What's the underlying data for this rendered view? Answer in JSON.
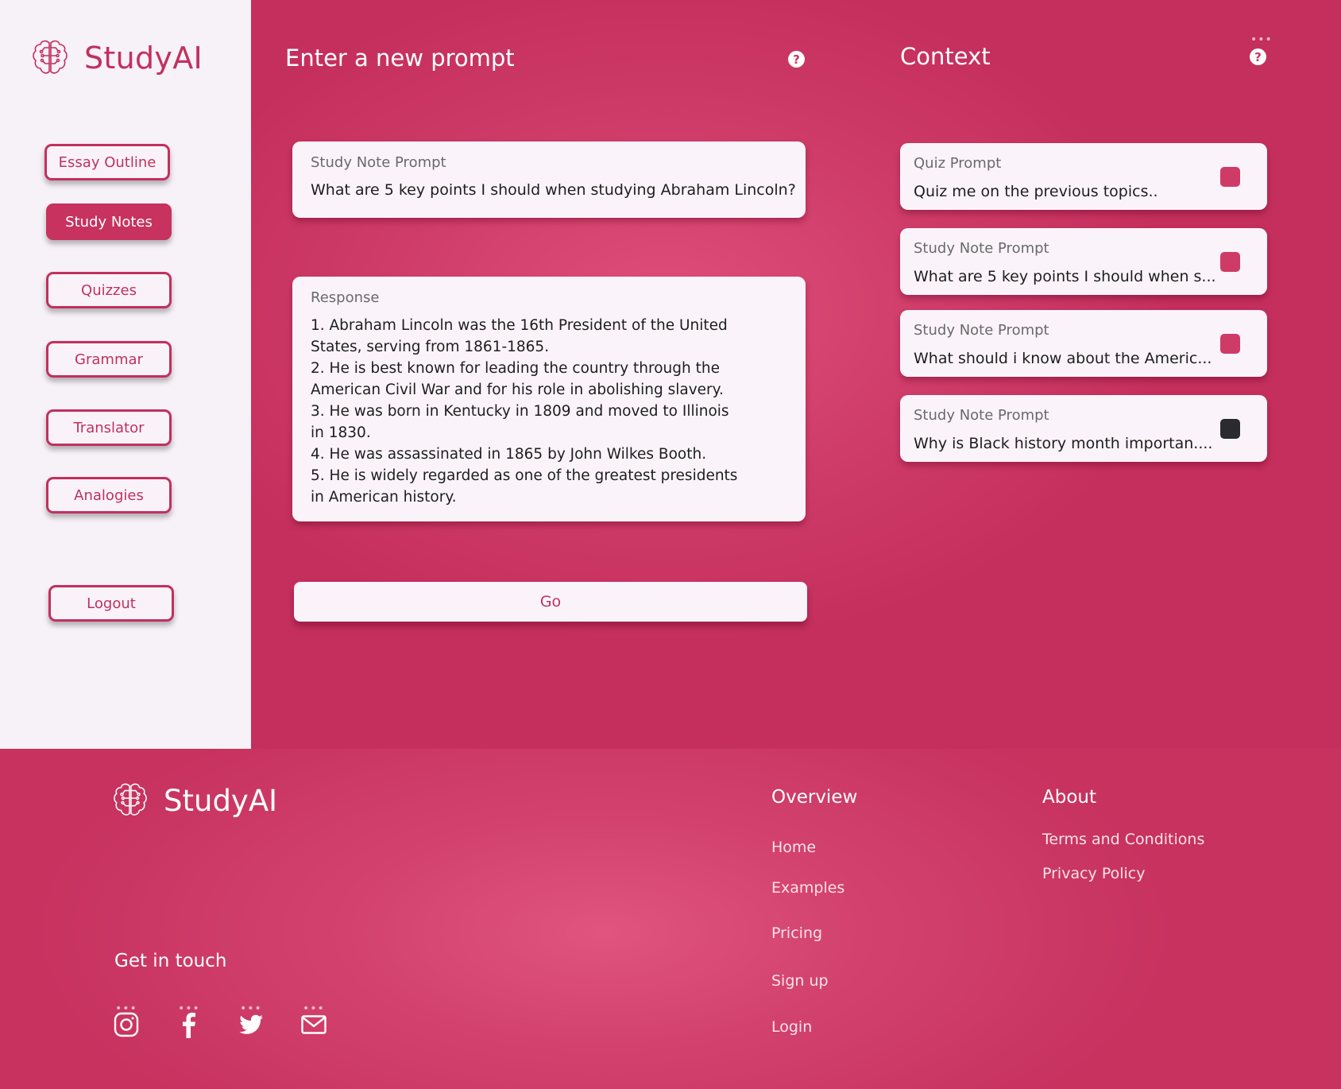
{
  "app": {
    "name": "StudyAI"
  },
  "sidebar": {
    "items": [
      {
        "label": "Essay Outline",
        "active": false
      },
      {
        "label": "Study Notes",
        "active": true
      },
      {
        "label": "Quizzes",
        "active": false
      },
      {
        "label": "Grammar",
        "active": false
      },
      {
        "label": "Translator",
        "active": false
      },
      {
        "label": "Analogies",
        "active": false
      }
    ],
    "logout_label": "Logout"
  },
  "prompt_panel": {
    "title": "Enter a new prompt",
    "help_icon": "question-circle-icon",
    "prompt_label": "Study Note Prompt",
    "prompt_text": "What are 5 key points I should when studying Abraham Lincoln?",
    "response_label": "Response",
    "response_lines": [
      "1. Abraham Lincoln was the 16th President of the United States, serving from 1861-1865.",
      "2. He is best known for leading the country through the American Civil War and for his role in abolishing slavery.",
      "3. He was born in Kentucky in 1809 and moved to Illinois in 1830.",
      "4. He was assassinated in 1865 by John Wilkes Booth.",
      "5. He is widely regarded as one of the greatest presidents in American history."
    ],
    "go_label": "Go"
  },
  "context_panel": {
    "title": "Context",
    "help_icon": "question-circle-icon",
    "items": [
      {
        "label": "Quiz Prompt",
        "text": "Quiz me on the previous topics..",
        "checkbox_color": "#cf3b67"
      },
      {
        "label": "Study Note Prompt",
        "text": "What are 5 key points I should when s...",
        "checkbox_color": "#cf3b67"
      },
      {
        "label": "Study Note Prompt",
        "text": "What should i know about the Americ...",
        "checkbox_color": "#cf3b67"
      },
      {
        "label": "Study Note Prompt",
        "text": "Why is Black history month importan....",
        "checkbox_color": "#2b2b2f"
      }
    ]
  },
  "footer": {
    "brand": "StudyAI",
    "overview": {
      "title": "Overview",
      "links": [
        "Home",
        "Examples",
        "Pricing",
        "Sign up",
        "Login"
      ]
    },
    "about": {
      "title": "About",
      "links": [
        "Terms and Conditions",
        "Privacy Policy"
      ]
    },
    "get_in_touch": "Get in touch",
    "social_icons": [
      "instagram-icon",
      "facebook-icon",
      "twitter-icon",
      "mail-icon"
    ]
  },
  "colors": {
    "accent": "#c93462",
    "sidebar_bg": "#f7f1f8",
    "card_bg": "#faf4fa",
    "dark_checkbox": "#2b2b2f"
  }
}
